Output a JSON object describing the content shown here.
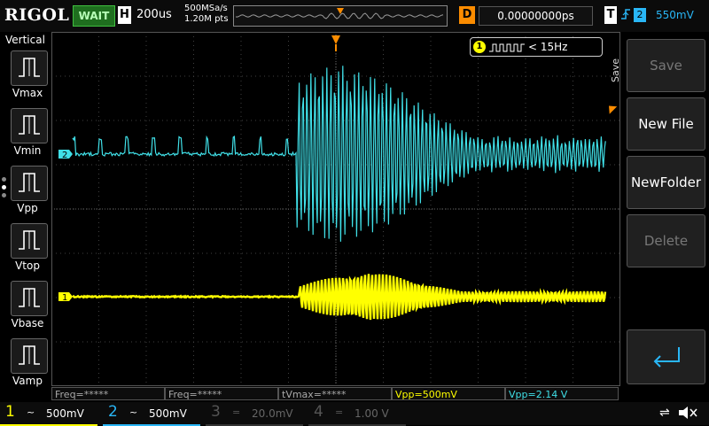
{
  "header": {
    "brand": "RIGOL",
    "run_status": "WAIT",
    "horizontal_label": "H",
    "timebase": "200us",
    "sample_rate": "500MSa/s",
    "memory_depth": "1.20M pts",
    "delay_label": "D",
    "delay_value": "0.00000000ps",
    "trigger_label": "T",
    "trigger_source": "2",
    "trigger_level": "550mV"
  },
  "left_menu": {
    "title": "Vertical",
    "items": [
      {
        "label": "Vmax"
      },
      {
        "label": "Vmin"
      },
      {
        "label": "Vpp"
      },
      {
        "label": "Vtop"
      },
      {
        "label": "Vbase"
      },
      {
        "label": "Vamp"
      }
    ]
  },
  "right_menu": {
    "side_label": "Save",
    "items": [
      {
        "label": "Save",
        "enabled": false
      },
      {
        "label": "New File",
        "enabled": true
      },
      {
        "label": "NewFolder",
        "enabled": true
      },
      {
        "label": "Delete",
        "enabled": false
      }
    ]
  },
  "display": {
    "freq_indicator_channel": "1",
    "freq_indicator_text": "< 15Hz",
    "ch2_marker": "2",
    "ch1_marker": "1"
  },
  "measurements": [
    "Freq=*****",
    "Freq=*****",
    "tVmax=*****",
    "Vpp=500mV",
    "Vpp=2.14 V"
  ],
  "channels": [
    {
      "num": "1",
      "coupling": "~",
      "scale": "500mV",
      "color": "#ffff00",
      "active": true
    },
    {
      "num": "2",
      "coupling": "~",
      "scale": "500mV",
      "color": "#29b6f6",
      "active": true
    },
    {
      "num": "3",
      "coupling": "=",
      "scale": "20.0mV",
      "color": "#c040c0",
      "active": false
    },
    {
      "num": "4",
      "coupling": "=",
      "scale": "1.00 V",
      "color": "#4060c0",
      "active": false
    }
  ],
  "colors": {
    "ch1": "#ffff00",
    "ch2": "#40e0e8",
    "trigger": "#fb8c00",
    "grid": "#404040"
  }
}
